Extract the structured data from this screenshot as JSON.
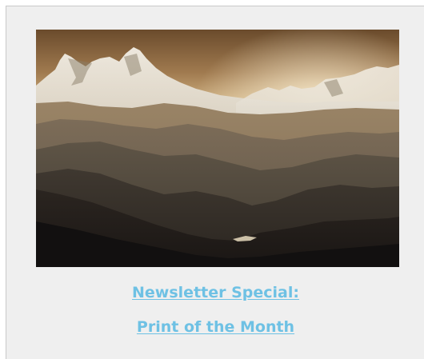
{
  "newsletter": {
    "headline_line_1": "Newsletter Special:",
    "headline_line_2": "Print of the Month",
    "link_color": "#6ec1e4"
  },
  "photo": {
    "subject": "layered mountain ridges at sunset"
  }
}
